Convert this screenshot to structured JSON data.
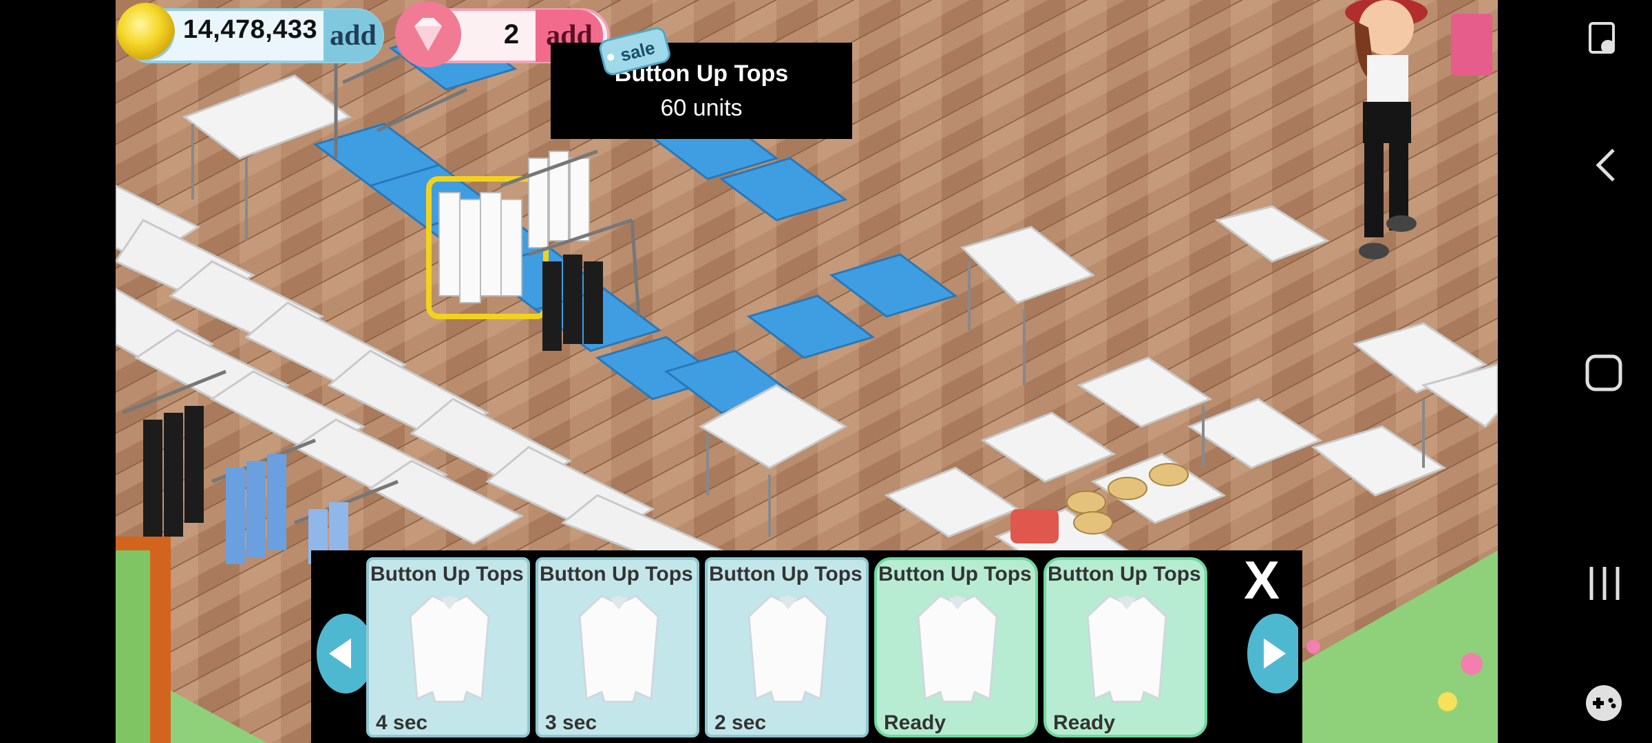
{
  "hud": {
    "coins": "14,478,433",
    "coin_add_label": "add",
    "gems": "2",
    "gem_add_label": "add",
    "sale_tag": "sale"
  },
  "tooltip": {
    "title": "Button Up Tops",
    "subtitle": "60 units"
  },
  "tray": {
    "close_label": "X",
    "items": [
      {
        "name": "Button Up Tops",
        "status": "4 sec",
        "state": "pending"
      },
      {
        "name": "Button Up Tops",
        "status": "3 sec",
        "state": "pending"
      },
      {
        "name": "Button Up Tops",
        "status": "2 sec",
        "state": "pending"
      },
      {
        "name": "Button Up Tops",
        "status": "Ready",
        "state": "ready"
      },
      {
        "name": "Button Up Tops",
        "status": "Ready",
        "state": "ready"
      }
    ]
  },
  "colors": {
    "floor": "#b88b6b",
    "table_blue": "#3d9be0",
    "table_white": "#f4f4f4",
    "card_pending": "#c3e6ea",
    "card_ready": "#b7ecd2",
    "selection_outline": "#f2d21d"
  },
  "system_nav": {
    "icons": [
      "screen-lock-icon",
      "back-icon",
      "home-icon",
      "recents-icon",
      "game-tools-icon"
    ]
  }
}
